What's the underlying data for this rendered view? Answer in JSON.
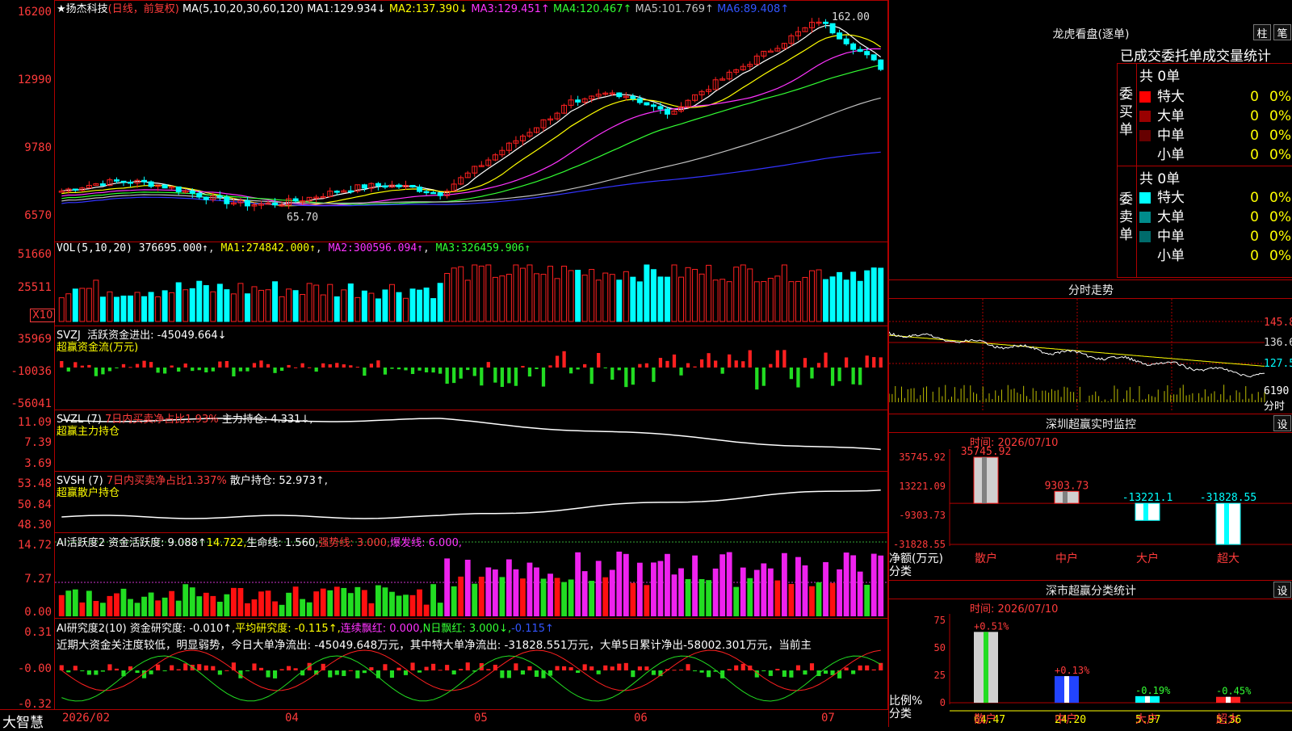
{
  "header": {
    "stock": "★扬杰科技",
    "mode": "(日线，前复权)",
    "ma_params": "MA(5,10,20,30,60,120)",
    "ma": [
      {
        "label": "MA1:",
        "value": "129.934↓",
        "color": "#ffffff"
      },
      {
        "label": "MA2:",
        "value": "137.390↓",
        "color": "#ffff00"
      },
      {
        "label": "MA3:",
        "value": "129.451↑",
        "color": "#ff33ff"
      },
      {
        "label": "MA4:",
        "value": "120.467↑",
        "color": "#33ff33"
      },
      {
        "label": "MA5:",
        "value": "101.769↑",
        "color": "#c0c0c0"
      },
      {
        "label": "MA6:",
        "value": "89.408↑",
        "color": "#3333ff"
      }
    ]
  },
  "price_axis": [
    "16200",
    "12990",
    "9780",
    "6570"
  ],
  "price_marks": {
    "high": "162.00",
    "low": "65.70"
  },
  "vol": {
    "params": "VOL(5,10,20)",
    "value": "376695.000↑",
    "ma": [
      {
        "label": "MA1:",
        "value": "274842.000↑",
        "color": "#ffff00"
      },
      {
        "label": "MA2:",
        "value": "300596.094↑",
        "color": "#ff33ff"
      },
      {
        "label": "MA3:",
        "value": "326459.906↑",
        "color": "#33ff33"
      }
    ],
    "axis": [
      "51660",
      "25511"
    ],
    "unit": "X10"
  },
  "svzj": {
    "name": "SVZJ",
    "line1": "活跃资金进出: -45049.664↓",
    "line2": "超赢资金流(万元)",
    "axis": [
      "35969",
      "-10036",
      "-56041"
    ]
  },
  "svzl": {
    "name": "SVZL",
    "param": "(7)",
    "red": "7日内买卖净占比1.93%",
    "line1": "主力持仓: 4.331↓,",
    "line2": "超赢主力持仓",
    "axis": [
      "11.09",
      "7.39",
      "3.69"
    ]
  },
  "svsh": {
    "name": "SVSH",
    "param": "(7)",
    "red": "7日内买卖净占比1.337%",
    "line1": "散户持仓: 52.973↑,",
    "line2": "超赢散户持仓",
    "axis": [
      "53.48",
      "50.84",
      "48.30"
    ]
  },
  "ai1": {
    "name": "AI活跃度2",
    "item1": "资金活跃度: 9.088↑",
    "item2": "14.722,",
    "item3": "生命线: 1.560,",
    "item4": "强势线: 3.000,",
    "item5": "爆发线: 6.000,",
    "axis": [
      "14.72",
      "7.27",
      "0.00"
    ]
  },
  "ai2": {
    "name": "AI研究度2(10)",
    "item1": "资金研究度: -0.010↑,",
    "item2": "平均研究度: -0.115↑,",
    "item3": "连续飘红: 0.000,",
    "item4": "N日飘红: 3.000↓,",
    "item5": "-0.115↑",
    "note": "近期大资金关注度较低，明显弱势，今日大单净流出: -45049.648万元，其中特大单净流出: -31828.551万元，大单5日累计净出-58002.301万元，当前主",
    "axis": [
      "0.31",
      "-0.00",
      "-0.32"
    ]
  },
  "date_axis": [
    "2026/02",
    "04",
    "05",
    "06",
    "07"
  ],
  "brand": "大智慧",
  "right": {
    "lhb": {
      "title": "龙虎看盘(逐单)",
      "btn1": "柱",
      "btn2": "笔"
    },
    "tabs": "已成交委托单成交量统计",
    "buy": {
      "side": "委买单",
      "total": "共 0单",
      "rows": [
        {
          "name": "特大",
          "count": "0",
          "pct": "0%",
          "color": "#ff0000"
        },
        {
          "name": "大单",
          "count": "0",
          "pct": "0%",
          "color": "#990000"
        },
        {
          "name": "中单",
          "count": "0",
          "pct": "0%",
          "color": "#660000"
        },
        {
          "name": "小单",
          "count": "0",
          "pct": "0%",
          "color": "#000000"
        }
      ]
    },
    "sell": {
      "side": "委卖单",
      "total": "共 0单",
      "rows": [
        {
          "name": "特大",
          "count": "0",
          "pct": "0%",
          "color": "#00ffff"
        },
        {
          "name": "大单",
          "count": "0",
          "pct": "0%",
          "color": "#008b8b"
        },
        {
          "name": "中单",
          "count": "0",
          "pct": "0%",
          "color": "#006b6b"
        },
        {
          "name": "小单",
          "count": "0",
          "pct": "0%",
          "color": "#000000"
        }
      ]
    },
    "intraday": {
      "title": "分时走势",
      "axis": [
        "145.8",
        "136.6",
        "127.5"
      ],
      "vol_axis": [
        "6190",
        "分时"
      ]
    },
    "monitor": {
      "title": "深圳超赢实时监控",
      "btn": "设",
      "time": "时间: 2026/07/10",
      "axis": [
        "35745.92",
        "13221.09",
        "-9303.73",
        "-31828.55"
      ],
      "unit1": "净额(万元)",
      "unit2": "分类",
      "categories": [
        "散户",
        "中户",
        "大户",
        "超大"
      ],
      "values": [
        35745.92,
        9303.73,
        -13221.1,
        -31828.55
      ],
      "labels": [
        "35745.92",
        "9303.73",
        "-13221.1",
        "-31828.55"
      ]
    },
    "classify": {
      "title": "深市超赢分类统计",
      "btn": "设",
      "time": "时间: 2026/07/10",
      "axis": [
        "75",
        "50",
        "25",
        "0"
      ],
      "unit1": "比例%",
      "unit2": "分类",
      "categories": [
        "散户",
        "中户",
        "大户",
        "超大"
      ],
      "values": [
        64.47,
        24.2,
        5.97,
        5.36
      ],
      "changes": [
        "+0.51%",
        "+0.13%",
        "-0.19%",
        "-0.45%"
      ]
    }
  },
  "chart_data": [
    {
      "type": "bar",
      "title": "深圳超赢实时监控",
      "categories": [
        "散户",
        "中户",
        "大户",
        "超大"
      ],
      "values": [
        35745.92,
        9303.73,
        -13221.1,
        -31828.55
      ],
      "ylabel": "净额(万元)",
      "ylim": [
        -31828.55,
        35745.92
      ]
    },
    {
      "type": "bar",
      "title": "深市超赢分类统计",
      "categories": [
        "散户",
        "中户",
        "大户",
        "超大"
      ],
      "values": [
        64.47,
        24.2,
        5.97,
        5.36
      ],
      "ylabel": "比例%",
      "ylim": [
        0,
        75
      ]
    }
  ]
}
